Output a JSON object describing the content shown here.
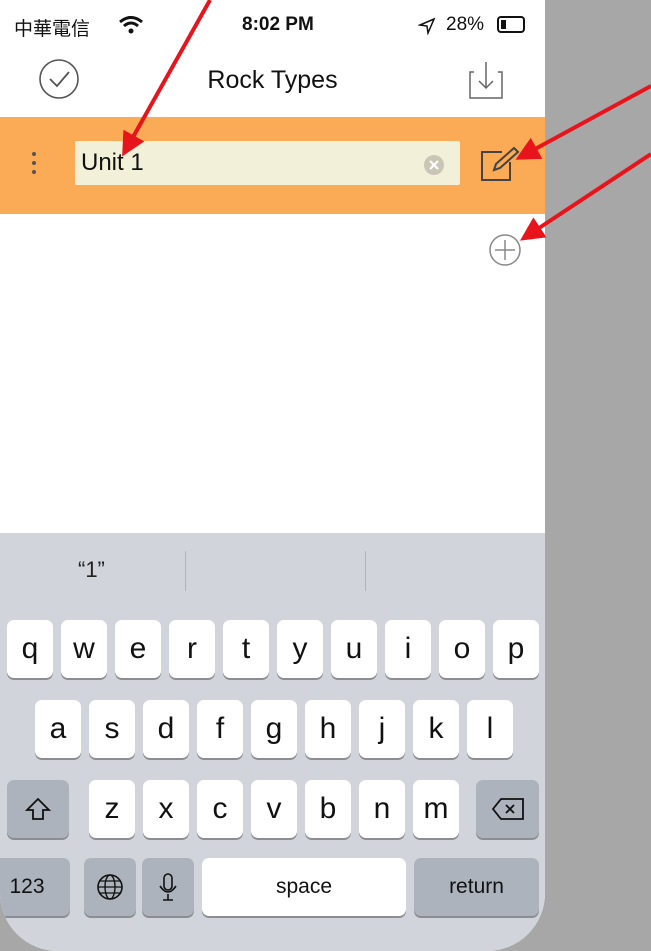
{
  "status_bar": {
    "carrier": "中華電信",
    "time": "8:02 PM",
    "battery": "28%"
  },
  "navbar": {
    "title": "Rock Types",
    "check_icon": "checkmark-circle-icon",
    "download_icon": "download-tray-icon"
  },
  "row": {
    "value": "Unit 1",
    "placeholder": "",
    "drag_icon": "drag-handle-icon",
    "clear_icon": "clear-icon",
    "edit_icon": "edit-square-icon"
  },
  "add_icon": "plus-circle-icon",
  "keyboard": {
    "suggestions": [
      "“1”",
      "",
      ""
    ],
    "row1": [
      "q",
      "w",
      "e",
      "r",
      "t",
      "y",
      "u",
      "i",
      "o",
      "p"
    ],
    "row2": [
      "a",
      "s",
      "d",
      "f",
      "g",
      "h",
      "j",
      "k",
      "l"
    ],
    "row3": [
      "z",
      "x",
      "c",
      "v",
      "b",
      "n",
      "m"
    ],
    "numbers_label": "123",
    "space_label": "space",
    "return_label": "return"
  },
  "colors": {
    "row": "#fbaa55",
    "field": "#f3f0da",
    "annotation_arrow": "#e8141c",
    "keyboard": "#d1d4da"
  }
}
